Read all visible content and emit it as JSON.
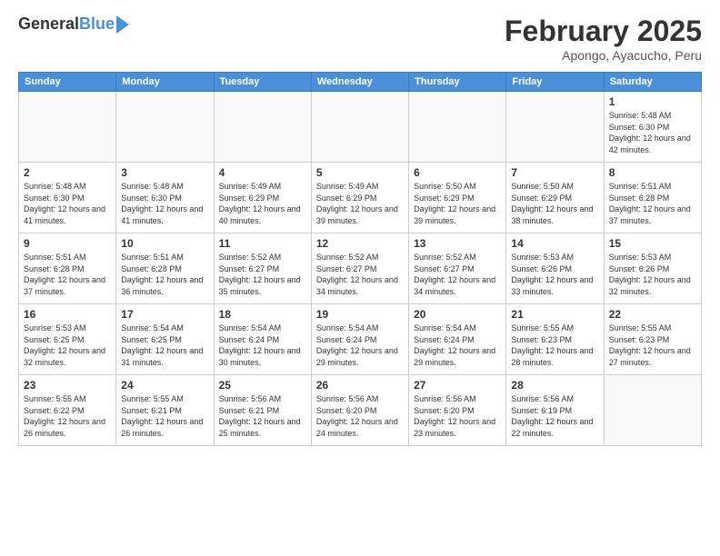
{
  "logo": {
    "general": "General",
    "blue": "Blue"
  },
  "title": "February 2025",
  "subtitle": "Apongo, Ayacucho, Peru",
  "weekdays": [
    "Sunday",
    "Monday",
    "Tuesday",
    "Wednesday",
    "Thursday",
    "Friday",
    "Saturday"
  ],
  "weeks": [
    [
      {
        "day": "",
        "info": ""
      },
      {
        "day": "",
        "info": ""
      },
      {
        "day": "",
        "info": ""
      },
      {
        "day": "",
        "info": ""
      },
      {
        "day": "",
        "info": ""
      },
      {
        "day": "",
        "info": ""
      },
      {
        "day": "1",
        "info": "Sunrise: 5:48 AM\nSunset: 6:30 PM\nDaylight: 12 hours\nand 42 minutes."
      }
    ],
    [
      {
        "day": "2",
        "info": "Sunrise: 5:48 AM\nSunset: 6:30 PM\nDaylight: 12 hours\nand 41 minutes."
      },
      {
        "day": "3",
        "info": "Sunrise: 5:48 AM\nSunset: 6:30 PM\nDaylight: 12 hours\nand 41 minutes."
      },
      {
        "day": "4",
        "info": "Sunrise: 5:49 AM\nSunset: 6:29 PM\nDaylight: 12 hours\nand 40 minutes."
      },
      {
        "day": "5",
        "info": "Sunrise: 5:49 AM\nSunset: 6:29 PM\nDaylight: 12 hours\nand 39 minutes."
      },
      {
        "day": "6",
        "info": "Sunrise: 5:50 AM\nSunset: 6:29 PM\nDaylight: 12 hours\nand 39 minutes."
      },
      {
        "day": "7",
        "info": "Sunrise: 5:50 AM\nSunset: 6:29 PM\nDaylight: 12 hours\nand 38 minutes."
      },
      {
        "day": "8",
        "info": "Sunrise: 5:51 AM\nSunset: 6:28 PM\nDaylight: 12 hours\nand 37 minutes."
      }
    ],
    [
      {
        "day": "9",
        "info": "Sunrise: 5:51 AM\nSunset: 6:28 PM\nDaylight: 12 hours\nand 37 minutes."
      },
      {
        "day": "10",
        "info": "Sunrise: 5:51 AM\nSunset: 6:28 PM\nDaylight: 12 hours\nand 36 minutes."
      },
      {
        "day": "11",
        "info": "Sunrise: 5:52 AM\nSunset: 6:27 PM\nDaylight: 12 hours\nand 35 minutes."
      },
      {
        "day": "12",
        "info": "Sunrise: 5:52 AM\nSunset: 6:27 PM\nDaylight: 12 hours\nand 34 minutes."
      },
      {
        "day": "13",
        "info": "Sunrise: 5:52 AM\nSunset: 6:27 PM\nDaylight: 12 hours\nand 34 minutes."
      },
      {
        "day": "14",
        "info": "Sunrise: 5:53 AM\nSunset: 6:26 PM\nDaylight: 12 hours\nand 33 minutes."
      },
      {
        "day": "15",
        "info": "Sunrise: 5:53 AM\nSunset: 6:26 PM\nDaylight: 12 hours\nand 32 minutes."
      }
    ],
    [
      {
        "day": "16",
        "info": "Sunrise: 5:53 AM\nSunset: 6:25 PM\nDaylight: 12 hours\nand 32 minutes."
      },
      {
        "day": "17",
        "info": "Sunrise: 5:54 AM\nSunset: 6:25 PM\nDaylight: 12 hours\nand 31 minutes."
      },
      {
        "day": "18",
        "info": "Sunrise: 5:54 AM\nSunset: 6:24 PM\nDaylight: 12 hours\nand 30 minutes."
      },
      {
        "day": "19",
        "info": "Sunrise: 5:54 AM\nSunset: 6:24 PM\nDaylight: 12 hours\nand 29 minutes."
      },
      {
        "day": "20",
        "info": "Sunrise: 5:54 AM\nSunset: 6:24 PM\nDaylight: 12 hours\nand 29 minutes."
      },
      {
        "day": "21",
        "info": "Sunrise: 5:55 AM\nSunset: 6:23 PM\nDaylight: 12 hours\nand 28 minutes."
      },
      {
        "day": "22",
        "info": "Sunrise: 5:55 AM\nSunset: 6:23 PM\nDaylight: 12 hours\nand 27 minutes."
      }
    ],
    [
      {
        "day": "23",
        "info": "Sunrise: 5:55 AM\nSunset: 6:22 PM\nDaylight: 12 hours\nand 26 minutes."
      },
      {
        "day": "24",
        "info": "Sunrise: 5:55 AM\nSunset: 6:21 PM\nDaylight: 12 hours\nand 26 minutes."
      },
      {
        "day": "25",
        "info": "Sunrise: 5:56 AM\nSunset: 6:21 PM\nDaylight: 12 hours\nand 25 minutes."
      },
      {
        "day": "26",
        "info": "Sunrise: 5:56 AM\nSunset: 6:20 PM\nDaylight: 12 hours\nand 24 minutes."
      },
      {
        "day": "27",
        "info": "Sunrise: 5:56 AM\nSunset: 6:20 PM\nDaylight: 12 hours\nand 23 minutes."
      },
      {
        "day": "28",
        "info": "Sunrise: 5:56 AM\nSunset: 6:19 PM\nDaylight: 12 hours\nand 22 minutes."
      },
      {
        "day": "",
        "info": ""
      }
    ]
  ]
}
